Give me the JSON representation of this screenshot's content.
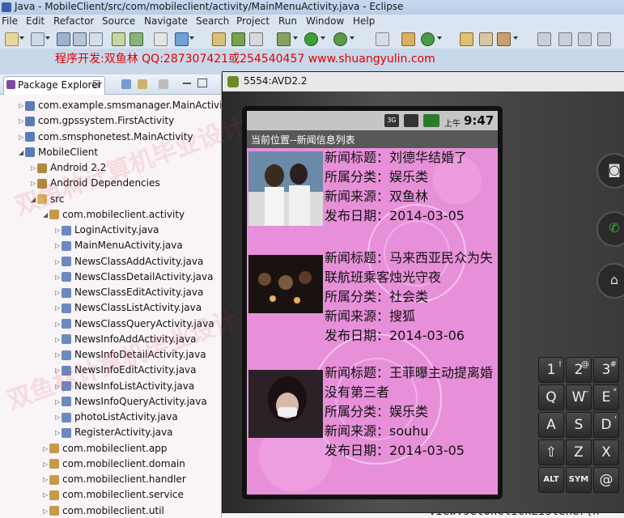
{
  "window": {
    "title": "Java - MobileClient/src/com/mobileclient/activity/MainMenuActivity.java - Eclipse"
  },
  "menu": [
    "File",
    "Edit",
    "Refactor",
    "Source",
    "Navigate",
    "Search",
    "Project",
    "Run",
    "Window",
    "Help"
  ],
  "banner": "程序开发:双鱼林 QQ:287307421或254540457 www.shuangyulin.com",
  "explorer": {
    "tab_label": "Package Explorer",
    "close_glyph": "☒",
    "items": [
      "com.example.smsmanager.MainActivity",
      "com.gpssystem.FirstActivity",
      "com.smsphonetest.MainActivity",
      "MobileClient",
      "Android 2.2",
      "Android Dependencies",
      "src",
      "com.mobileclient.activity",
      "LoginActivity.java",
      "MainMenuActivity.java",
      "NewsClassAddActivity.java",
      "NewsClassDetailActivity.java",
      "NewsClassEditActivity.java",
      "NewsClassListActivity.java",
      "NewsClassQueryActivity.java",
      "NewsInfoAddActivity.java",
      "NewsInfoDetailActivity.java",
      "NewsInfoEditActivity.java",
      "NewsInfoListActivity.java",
      "NewsInfoQueryActivity.java",
      "photoListActivity.java",
      "RegisterActivity.java",
      "com.mobileclient.app",
      "com.mobileclient.domain",
      "com.mobileclient.handler",
      "com.mobileclient.service",
      "com.mobileclient.util"
    ]
  },
  "editor": {
    "code_fragment": "view.setOnClickListener(n"
  },
  "emulator": {
    "title": "5554:AVD2.2",
    "status": {
      "ampm": "上午",
      "time": "9:47",
      "network": "3G"
    },
    "location_title": "当前位置--新闻信息列表",
    "news": [
      {
        "title": "新闻标题：刘德华结婚了",
        "category": "所属分类：娱乐类",
        "source": "新闻来源：双鱼林",
        "date": "发布日期：2014-03-05"
      },
      {
        "title": "新闻标题：马来西亚民众为失联航班乘客烛光守夜",
        "category": "所属分类：社会类",
        "source": "新闻来源：搜狐",
        "date": "发布日期：2014-03-06"
      },
      {
        "title": "新闻标题：王菲曝主动提离婚没有第三者",
        "category": "所属分类：娱乐类",
        "source": "新闻来源：souhu",
        "date": "发布日期：2014-03-05"
      }
    ],
    "keys": [
      {
        "main": "1",
        "alt": "!"
      },
      {
        "main": "2",
        "alt": "@"
      },
      {
        "main": "3",
        "alt": "#"
      },
      {
        "main": "Q",
        "alt": ""
      },
      {
        "main": "W",
        "alt": "~"
      },
      {
        "main": "E",
        "alt": "\""
      },
      {
        "main": "A",
        "alt": ""
      },
      {
        "main": "S",
        "alt": ""
      },
      {
        "main": "D",
        "alt": "'"
      },
      {
        "main": "⇧",
        "alt": ""
      },
      {
        "main": "Z",
        "alt": ""
      },
      {
        "main": "X",
        "alt": ""
      },
      {
        "main": "ALT",
        "alt": ""
      },
      {
        "main": "SYM",
        "alt": ""
      },
      {
        "main": "@",
        "alt": ""
      }
    ]
  },
  "watermark": "双鱼林计算机毕业设计",
  "colors": {
    "banner_text": "#e00000",
    "screen_bg": "#e790d9",
    "explorer_bg": "#f9f4f7"
  }
}
